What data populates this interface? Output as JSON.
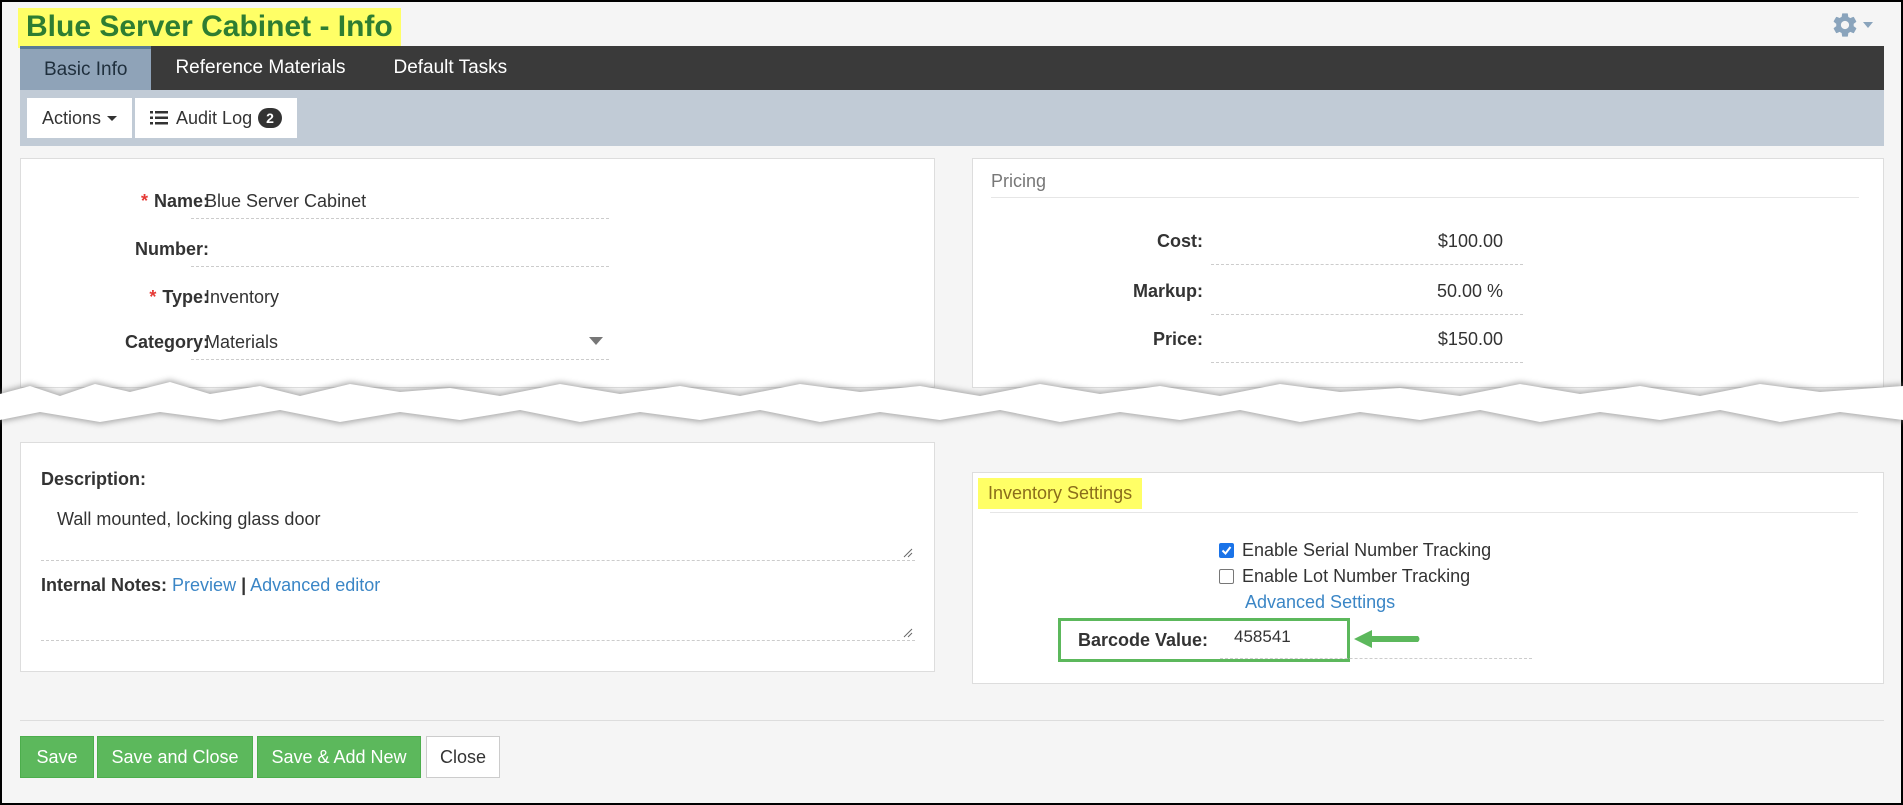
{
  "header": {
    "title": "Blue Server Cabinet - Info",
    "settings_icon": "gear-icon"
  },
  "tabs": [
    {
      "label": "Basic Info",
      "active": true
    },
    {
      "label": "Reference Materials",
      "active": false
    },
    {
      "label": "Default Tasks",
      "active": false
    }
  ],
  "toolbar": {
    "actions_label": "Actions",
    "audit_log_label": "Audit Log",
    "audit_log_count": "2"
  },
  "basic": {
    "name_label": "Name:",
    "name_value": "Blue Server Cabinet",
    "number_label": "Number:",
    "number_value": "",
    "type_label": "Type:",
    "type_value": "Inventory",
    "category_label": "Category:",
    "category_value": "Materials"
  },
  "pricing": {
    "title": "Pricing",
    "cost_label": "Cost:",
    "cost_value": "$100.00",
    "markup_label": "Markup:",
    "markup_value": "50.00 %",
    "price_label": "Price:",
    "price_value": "$150.00"
  },
  "description": {
    "label": "Description:",
    "value": "Wall mounted, locking glass door",
    "notes_label": "Internal Notes:",
    "preview_link": "Preview",
    "separator": "|",
    "advanced_editor_link": "Advanced editor"
  },
  "inventory": {
    "title": "Inventory Settings",
    "serial_label": "Enable Serial Number Tracking",
    "serial_checked": true,
    "lot_label": "Enable Lot Number Tracking",
    "lot_checked": false,
    "advanced_settings_link": "Advanced Settings",
    "barcode_label": "Barcode Value:",
    "barcode_value": "458541"
  },
  "footer": {
    "save": "Save",
    "save_close": "Save and Close",
    "save_add_new": "Save & Add New",
    "close": "Close"
  },
  "colors": {
    "highlight": "#ffff66",
    "tab_bar": "#3a3a3a",
    "toolbar": "#c1cbd6",
    "primary_green": "#5cb85c",
    "link": "#3b86c6"
  }
}
